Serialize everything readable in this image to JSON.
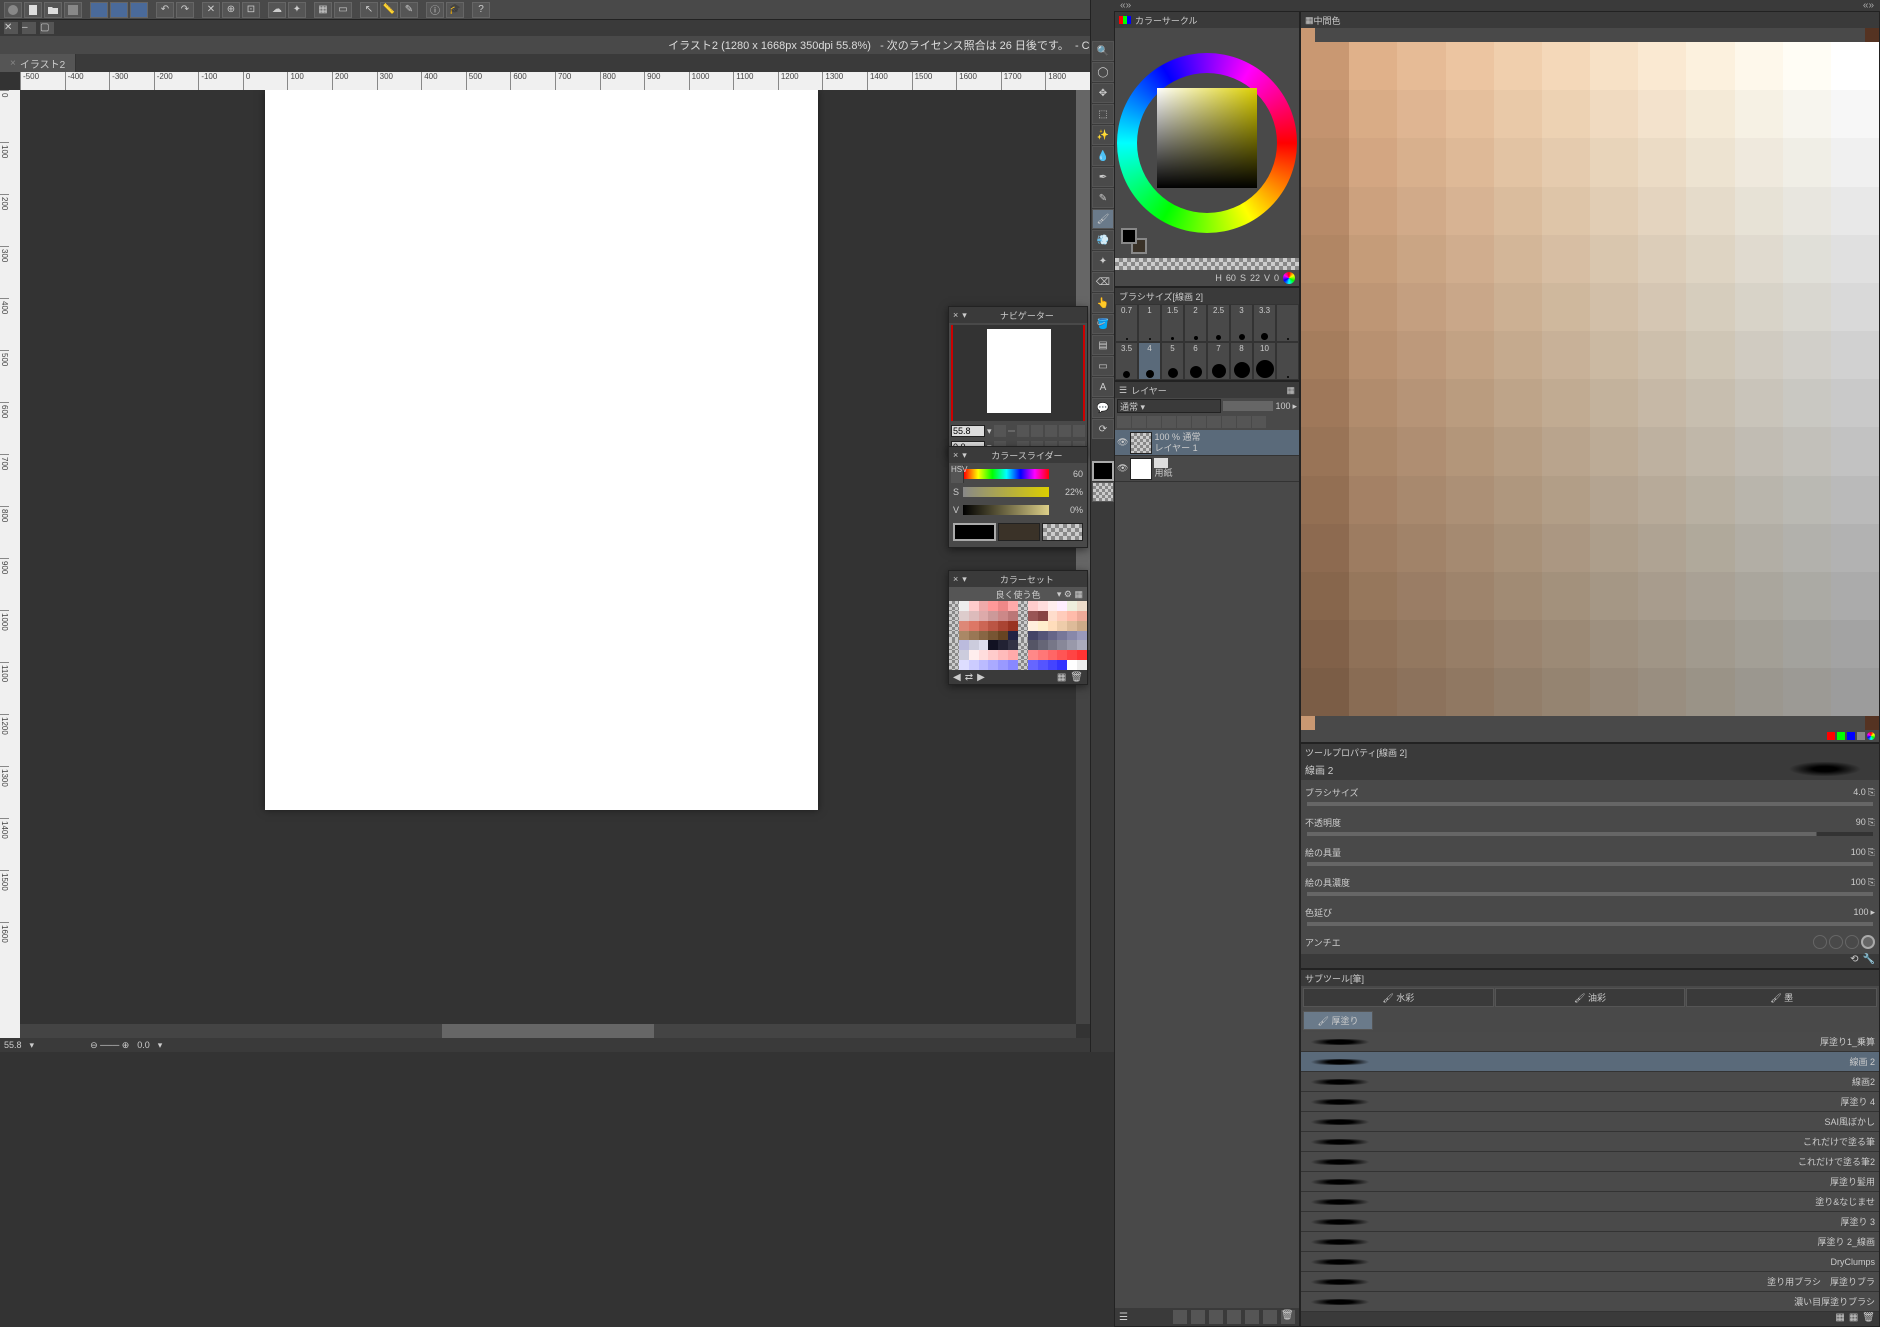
{
  "title_bar": {
    "doc_info": "イラスト2 (1280 x 1668px 350dpi 55.8%)",
    "license_info": "- 次のライセンス照合は 26 日後です。",
    "app_name": "- CLIP STUDIO PAINT PRO"
  },
  "document_tab": {
    "name": "イラスト2"
  },
  "ruler_marks_h": [
    "-500",
    "-400",
    "-300",
    "-200",
    "-100",
    "0",
    "100",
    "200",
    "300",
    "400",
    "500",
    "600",
    "700",
    "800",
    "900",
    "1000",
    "1100",
    "1200",
    "1300",
    "1400",
    "1500",
    "1600",
    "1700",
    "1800"
  ],
  "ruler_marks_v": [
    "0",
    "100",
    "200",
    "300",
    "400",
    "500",
    "600",
    "700",
    "800",
    "900",
    "1000",
    "1100",
    "1200",
    "1300",
    "1400",
    "1500",
    "1600"
  ],
  "status": {
    "zoom": "55.8",
    "rotation": "0.0"
  },
  "navigator": {
    "title": "ナビゲーター",
    "zoom": "55.8",
    "rotation": "0.0"
  },
  "color_slider": {
    "title": "カラースライダー",
    "h_label": "H",
    "h_value": "60",
    "s_label": "S",
    "s_value": "22%",
    "v_label": "V",
    "v_value": "0%"
  },
  "color_set": {
    "title": "カラーセット",
    "subset": "良く使う色"
  },
  "color_circle": {
    "title": "カラーサークル",
    "readout_h_label": "H",
    "readout_h": "60",
    "readout_s_label": "S",
    "readout_s": "22",
    "readout_v_label": "V",
    "readout_v": "0"
  },
  "intermediate": {
    "title": "中間色"
  },
  "brush_size_panel": {
    "title": "ブラシサイズ[線画 2]",
    "sizes": [
      "0.7",
      "1",
      "1.5",
      "2",
      "2.5",
      "3",
      "3.3",
      "",
      "3.5",
      "4",
      "5",
      "6",
      "7",
      "8",
      "10",
      ""
    ]
  },
  "layers": {
    "title": "レイヤー",
    "blend_mode": "通常",
    "opacity": "100",
    "layer1": {
      "opacity_line": "100 % 通常",
      "name": "レイヤー 1"
    },
    "paper": {
      "name": "用紙"
    }
  },
  "tool_property": {
    "title": "ツールプロパティ[線画 2]",
    "preset": "線画 2",
    "size_label": "ブラシサイズ",
    "size_value": "4.0",
    "opacity_label": "不透明度",
    "opacity_value": "90",
    "paint_label": "絵の具量",
    "paint_value": "100",
    "density_label": "絵の具濃度",
    "density_value": "100",
    "stretch_label": "色延び",
    "stretch_value": "100",
    "aa_label": "アンチエ"
  },
  "subtool": {
    "title": "サブツール[筆]",
    "tab1": "水彩",
    "tab2": "油彩",
    "tab3": "墨",
    "active": "厚塗り",
    "presets": [
      "厚塗り1_乗算",
      "線画 2",
      "線画2",
      "厚塗り 4",
      "SAI風ぼかし",
      "これだけで塗る筆",
      "これだけで塗る筆2",
      "厚塗り髪用",
      "塗り&なじませ",
      "厚塗り 3",
      "厚塗り 2_線画",
      "DryClumps",
      "塗り用ブラシ　厚塗りブラ",
      "濃い目厚塗りブラシ"
    ]
  },
  "swatch_colors_top": [
    "#c99872",
    "#e0b18a",
    "#e6bb96",
    "#ecc5a1",
    "#f0cfad",
    "#f4d8b9",
    "#f7e1c6",
    "#fae9d2",
    "#fcf1de",
    "#fef8eb",
    "#fffdf5",
    "#ffffff"
  ],
  "colorset_palette": [
    "#fff",
    "#eee",
    "#fcc",
    "#eaa",
    "#f99",
    "#e88",
    "#faa",
    "#fbb",
    "#fcc",
    "#fdd",
    "#fee",
    "#fef",
    "#eed",
    "#edc",
    "#ecb",
    "#dcc",
    "#dbb",
    "#daa",
    "#c99",
    "#c88",
    "#b77",
    "#a66",
    "#955",
    "#844",
    "#fdc",
    "#fcb",
    "#fba",
    "#ea9",
    "#e98",
    "#d87",
    "#d76",
    "#c65",
    "#b54",
    "#a43",
    "#932",
    "#821",
    "#fed",
    "#fec",
    "#fdb",
    "#eca",
    "#db9",
    "#ca8",
    "#b97",
    "#a86",
    "#975",
    "#864",
    "#753",
    "#642",
    "#224",
    "#335",
    "#446",
    "#557",
    "#668",
    "#779",
    "#88a",
    "#99b",
    "#aac",
    "#bbd",
    "#ccd",
    "#dde",
    "#112",
    "#223",
    "#334",
    "#445",
    "#556",
    "#667",
    "#778",
    "#889",
    "#99a",
    "#aab",
    "#bbc",
    "#ccd",
    "#fee",
    "#fdd",
    "#fcc",
    "#fbb",
    "#faa",
    "#f99",
    "#f88",
    "#f77",
    "#f66",
    "#f55",
    "#f44",
    "#f33",
    "#eef",
    "#ddf",
    "#ccf",
    "#bbf",
    "#aaf",
    "#99f",
    "#88f",
    "#77f",
    "#66f",
    "#55f",
    "#44f",
    "#33f"
  ]
}
